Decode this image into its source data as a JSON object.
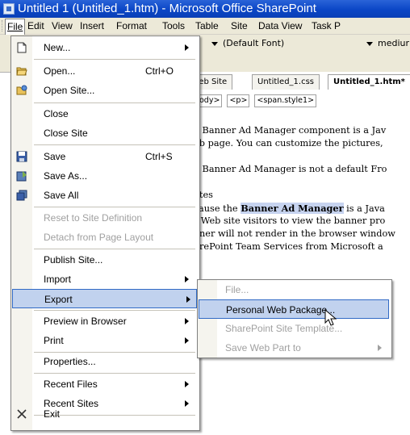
{
  "window": {
    "title": "Untitled 1 (Untitled_1.htm) - Microsoft Office SharePoint"
  },
  "menubar": [
    "File",
    "Edit",
    "View",
    "Insert",
    "Format",
    "Tools",
    "Table",
    "Site",
    "Data View",
    "Task P"
  ],
  "toolbar": {
    "font_value": "(Default Font)",
    "size_value": "mediur"
  },
  "tabs": [
    "Web Site",
    "Untitled_1.css",
    "Untitled_1.htm*"
  ],
  "breadcrumbs": [
    "<body>",
    "<p>",
    "<span.style1>"
  ],
  "document": {
    "lines": [
      "he Banner Ad Manager component is a Jav",
      "Veb page. You can customize the pictures,",
      "he Banner Ad Manager is not a default Fro",
      "Votes",
      "ecause the ",
      "Banner Ad Manager",
      " is a Java",
      "or Web site visitors to view the banner pro",
      "anner will not render in the browser window",
      "harePoint Team Services from Microsoft a"
    ]
  },
  "file_menu": {
    "items": [
      {
        "label": "New...",
        "icon": "new-page-icon",
        "submenu": true
      },
      {
        "label": "Open...",
        "shortcut": "Ctrl+O",
        "icon": "open-folder-icon"
      },
      {
        "label": "Open Site...",
        "icon": "open-site-icon"
      },
      {
        "label": "Close"
      },
      {
        "label": "Close Site"
      },
      {
        "label": "Save",
        "shortcut": "Ctrl+S",
        "icon": "save-disk-icon"
      },
      {
        "label": "Save As...",
        "icon": "save-as-icon"
      },
      {
        "label": "Save All",
        "icon": "save-all-icon"
      },
      {
        "label": "Reset to Site Definition",
        "disabled": true
      },
      {
        "label": "Detach from Page Layout",
        "disabled": true
      },
      {
        "label": "Publish Site..."
      },
      {
        "label": "Import",
        "submenu": true
      },
      {
        "label": "Export",
        "submenu": true,
        "highlighted": true
      },
      {
        "label": "Preview in Browser",
        "submenu": true
      },
      {
        "label": "Print",
        "submenu": true
      },
      {
        "label": "Properties..."
      },
      {
        "label": "Recent Files",
        "submenu": true
      },
      {
        "label": "Recent Sites",
        "submenu": true
      },
      {
        "label": "Exit",
        "icon": "exit-x-icon"
      }
    ]
  },
  "export_submenu": {
    "items": [
      {
        "label": "File...",
        "disabled": true
      },
      {
        "label": "Personal Web Package...",
        "highlighted": true
      },
      {
        "label": "SharePoint Site Template...",
        "disabled": true
      },
      {
        "label": "Save Web Part to",
        "disabled": true,
        "submenu": true
      }
    ]
  }
}
